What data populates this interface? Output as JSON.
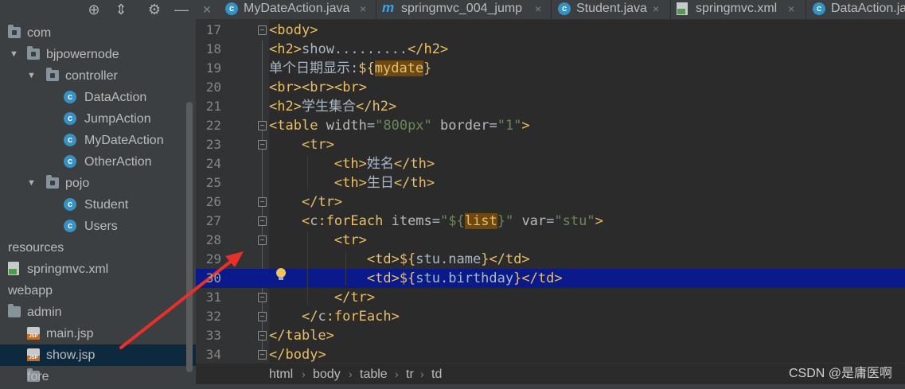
{
  "toolbar": {
    "icons": [
      "crosshair-icon",
      "collapse-icon",
      "gear-icon",
      "minimize-icon"
    ]
  },
  "tree": {
    "items": [
      {
        "label": "com",
        "icon": "package-folder-icon",
        "arrow": ""
      },
      {
        "label": "bjpowernode",
        "icon": "package-folder-icon",
        "arrow": "▼"
      },
      {
        "label": "controller",
        "icon": "package-folder-icon",
        "arrow": "▼"
      },
      {
        "label": "DataAction",
        "icon": "java-class-icon",
        "arrow": ""
      },
      {
        "label": "JumpAction",
        "icon": "java-class-icon",
        "arrow": ""
      },
      {
        "label": "MyDateAction",
        "icon": "java-class-icon",
        "arrow": ""
      },
      {
        "label": "OtherAction",
        "icon": "java-class-icon",
        "arrow": ""
      },
      {
        "label": "pojo",
        "icon": "package-folder-icon",
        "arrow": "▼"
      },
      {
        "label": "Student",
        "icon": "java-class-icon",
        "arrow": ""
      },
      {
        "label": "Users",
        "icon": "java-class-icon",
        "arrow": ""
      },
      {
        "label": "resources",
        "icon": "",
        "arrow": ""
      },
      {
        "label": "springmvc.xml",
        "icon": "xml-file-icon",
        "arrow": ""
      },
      {
        "label": "webapp",
        "icon": "",
        "arrow": ""
      },
      {
        "label": "admin",
        "icon": "folder-icon",
        "arrow": ""
      },
      {
        "label": "main.jsp",
        "icon": "jsp-file-icon",
        "arrow": ""
      },
      {
        "label": "show.jsp",
        "icon": "jsp-file-icon",
        "arrow": "",
        "selected": true
      },
      {
        "label": "fore",
        "icon": "folder-icon",
        "arrow": ""
      }
    ]
  },
  "tabs": [
    {
      "label": "MyDateAction.java",
      "icon": "java-class-icon",
      "close": "×"
    },
    {
      "label": "springmvc_004_jump",
      "icon": "maven-module-icon",
      "close": "×"
    },
    {
      "label": "Student.java",
      "icon": "java-class-icon",
      "close": "×"
    },
    {
      "label": "springmvc.xml",
      "icon": "xml-file-icon",
      "close": "×"
    },
    {
      "label": "DataAction.ja",
      "icon": "java-class-icon",
      "close": ""
    }
  ],
  "editor": {
    "current_line": 30,
    "lines": [
      {
        "n": "17",
        "code": "<body>"
      },
      {
        "n": "18",
        "code": "<h2>show.........</h2>"
      },
      {
        "n": "19",
        "code": "单个日期显示:${mydate}"
      },
      {
        "n": "20",
        "code": "<br><br><br>"
      },
      {
        "n": "21",
        "code": "<h2>学生集合</h2>"
      },
      {
        "n": "22",
        "code": "<table width=\"800px\" border=\"1\">"
      },
      {
        "n": "23",
        "code": "    <tr>"
      },
      {
        "n": "24",
        "code": "        <th>姓名</th>"
      },
      {
        "n": "25",
        "code": "        <th>生日</th>"
      },
      {
        "n": "26",
        "code": "    </tr>"
      },
      {
        "n": "27",
        "code": "    <c:forEach items=\"${list}\" var=\"stu\">"
      },
      {
        "n": "28",
        "code": "        <tr>"
      },
      {
        "n": "29",
        "code": "            <td>${stu.name}</td>"
      },
      {
        "n": "30",
        "code": "            <td>${stu.birthday}</td>"
      },
      {
        "n": "31",
        "code": "        </tr>"
      },
      {
        "n": "32",
        "code": "    </c:forEach>"
      },
      {
        "n": "33",
        "code": "</table>"
      },
      {
        "n": "34",
        "code": "</body>"
      }
    ]
  },
  "breadcrumb": {
    "items": [
      "html",
      "body",
      "table",
      "tr",
      "td"
    ],
    "separator": "›"
  },
  "watermark": "CSDN @是庸医啊",
  "colors": {
    "annotation_arrow": "#e8302a",
    "current_line_bg": "#0a1a8a",
    "selected_row_bg": "#0d293e"
  }
}
